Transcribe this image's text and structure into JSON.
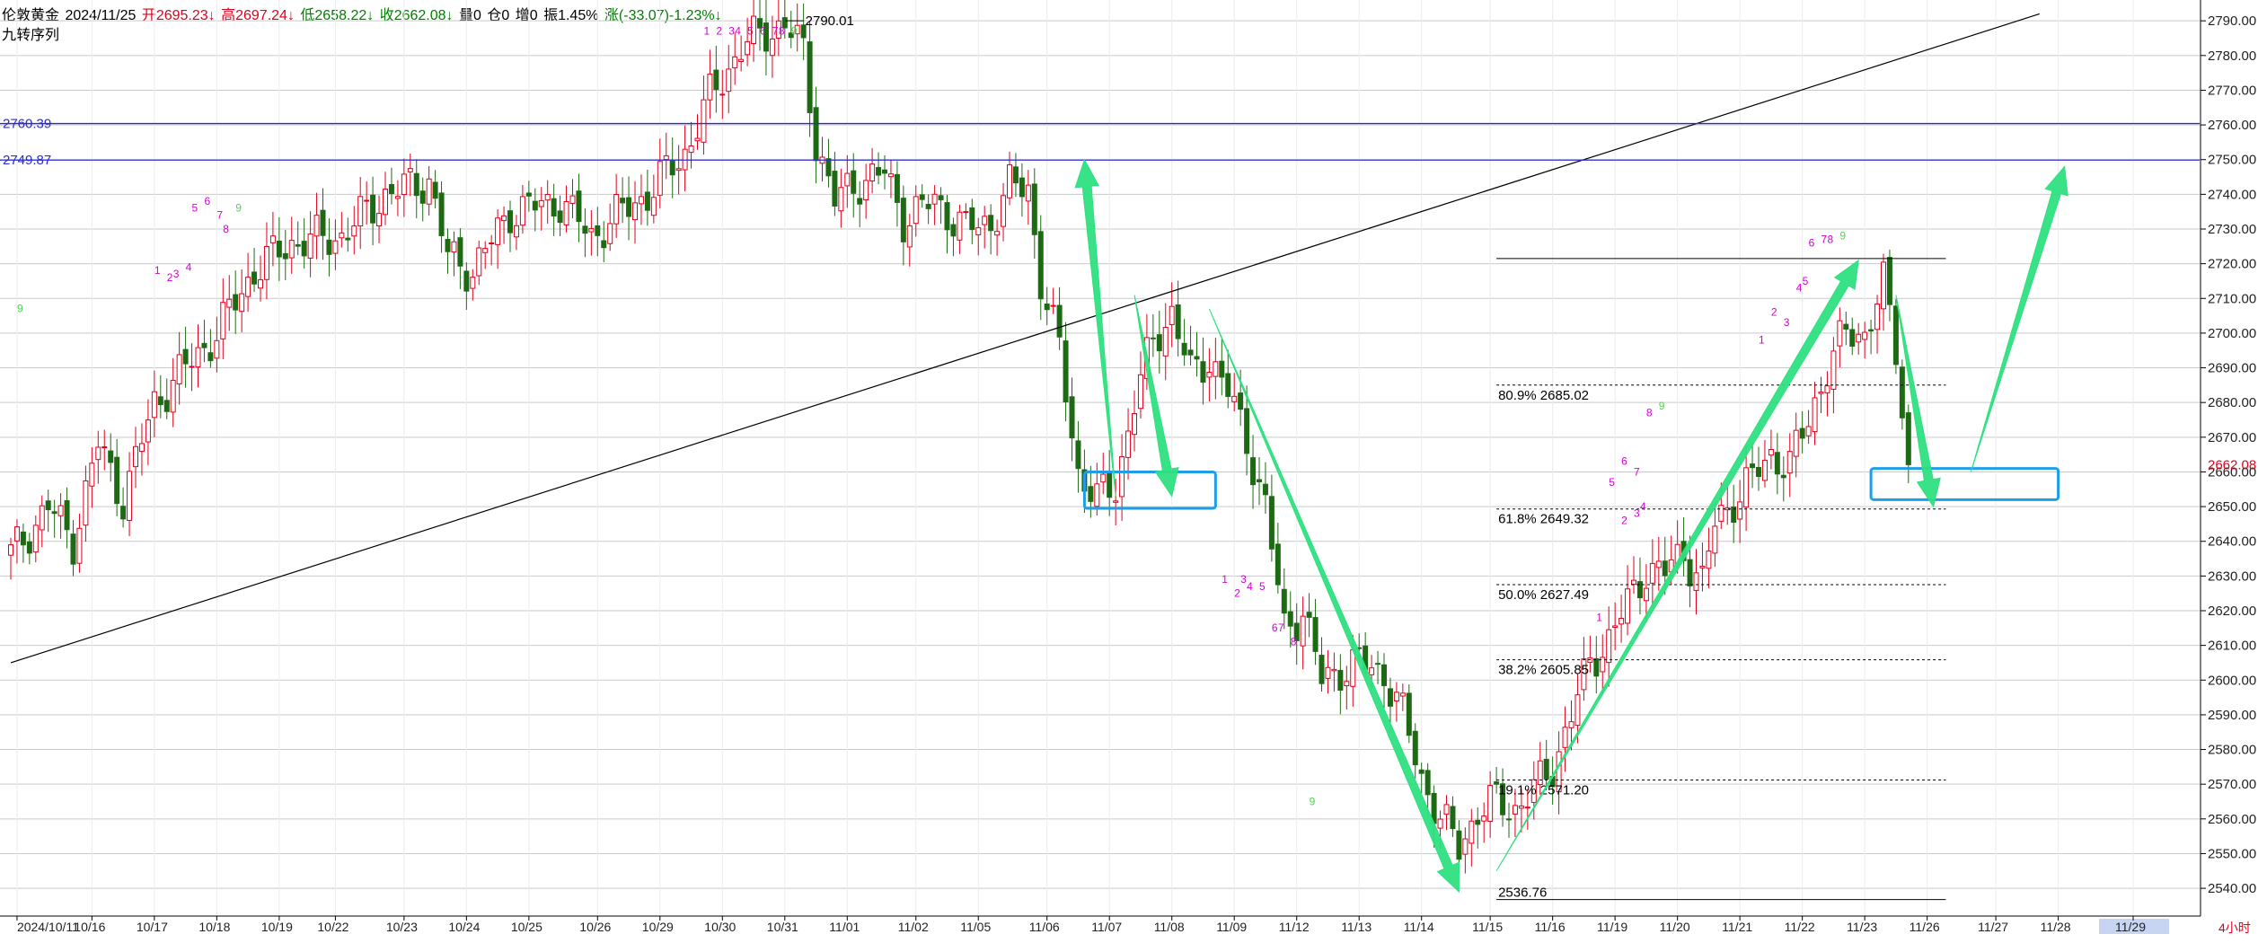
{
  "header": {
    "symbol": "伦敦黄金",
    "date": "2024/11/25",
    "open": "开2695.23↓",
    "high": "高2697.24↓",
    "low": "低2658.22↓",
    "close": "收2662.08↓",
    "volume": "量0",
    "position": "仓0",
    "increase": "增0",
    "amplitude": "振1.45%",
    "change": "涨(-33.07)-1.23%↓",
    "indicator": "九转序列"
  },
  "colors": {
    "bull": "#e0001b",
    "bear": "#1e6a14",
    "hline": "#2b2bd4",
    "trend": "#000000",
    "arrow": "#2ee07f",
    "box": "#1e9ee6",
    "td_setup": "#d400d4",
    "td_nine": "#4fd44f",
    "grid": "#c9c9c9"
  },
  "chart_data": {
    "type": "candlestick",
    "title": "",
    "ylim": [
      2532,
      2796
    ],
    "y_ticks": [
      "2540.00",
      "2550.00",
      "2560.00",
      "2570.00",
      "2580.00",
      "2590.00",
      "2600.00",
      "2610.00",
      "2620.00",
      "2630.00",
      "2640.00",
      "2650.00",
      "2660.00",
      "2670.00",
      "2680.00",
      "2690.00",
      "2700.00",
      "2710.00",
      "2720.00",
      "2730.00",
      "2740.00",
      "2750.00",
      "2760.00",
      "2770.00",
      "2780.00",
      "2790.00"
    ],
    "x_ticks": [
      {
        "i": 1,
        "label": "2024/10/11"
      },
      {
        "i": 13,
        "label": "10/16"
      },
      {
        "i": 23,
        "label": "10/17"
      },
      {
        "i": 33,
        "label": "10/18"
      },
      {
        "i": 43,
        "label": "10/19"
      },
      {
        "i": 52,
        "label": "10/22"
      },
      {
        "i": 63,
        "label": "10/23"
      },
      {
        "i": 73,
        "label": "10/24"
      },
      {
        "i": 83,
        "label": "10/25"
      },
      {
        "i": 94,
        "label": "10/26"
      },
      {
        "i": 104,
        "label": "10/29"
      },
      {
        "i": 114,
        "label": "10/30"
      },
      {
        "i": 124,
        "label": "10/31"
      },
      {
        "i": 134,
        "label": "11/01"
      },
      {
        "i": 145,
        "label": "11/02"
      },
      {
        "i": 155,
        "label": "11/05"
      },
      {
        "i": 166,
        "label": "11/06"
      },
      {
        "i": 176,
        "label": "11/07"
      },
      {
        "i": 186,
        "label": "11/08"
      },
      {
        "i": 196,
        "label": "11/09"
      },
      {
        "i": 206,
        "label": "11/12"
      },
      {
        "i": 216,
        "label": "11/13"
      },
      {
        "i": 226,
        "label": "11/14"
      },
      {
        "i": 237,
        "label": "11/15"
      },
      {
        "i": 247,
        "label": "11/16"
      },
      {
        "i": 257,
        "label": "11/19"
      },
      {
        "i": 267,
        "label": "11/20"
      },
      {
        "i": 277,
        "label": "11/21"
      },
      {
        "i": 287,
        "label": "11/22"
      },
      {
        "i": 297,
        "label": "11/23"
      },
      {
        "i": 307,
        "label": "11/26"
      },
      {
        "i": 318,
        "label": "11/27"
      },
      {
        "i": 328,
        "label": "11/28"
      },
      {
        "i": 340,
        "label": "11/29"
      }
    ],
    "x_axis_unit": "4小时",
    "x_axis_highlight": "11/29",
    "anchors": [
      {
        "i": 0,
        "p": 2636
      },
      {
        "i": 6,
        "p": 2650
      },
      {
        "i": 10,
        "p": 2640
      },
      {
        "i": 14,
        "p": 2668
      },
      {
        "i": 18,
        "p": 2652
      },
      {
        "i": 23,
        "p": 2680
      },
      {
        "i": 28,
        "p": 2690
      },
      {
        "i": 33,
        "p": 2700
      },
      {
        "i": 39,
        "p": 2718
      },
      {
        "i": 45,
        "p": 2726
      },
      {
        "i": 53,
        "p": 2728
      },
      {
        "i": 60,
        "p": 2740
      },
      {
        "i": 67,
        "p": 2744
      },
      {
        "i": 70,
        "p": 2722
      },
      {
        "i": 74,
        "p": 2718
      },
      {
        "i": 80,
        "p": 2735
      },
      {
        "i": 88,
        "p": 2738
      },
      {
        "i": 93,
        "p": 2728
      },
      {
        "i": 98,
        "p": 2735
      },
      {
        "i": 102,
        "p": 2740
      },
      {
        "i": 108,
        "p": 2752
      },
      {
        "i": 112,
        "p": 2768
      },
      {
        "i": 117,
        "p": 2782
      },
      {
        "i": 120,
        "p": 2786
      },
      {
        "i": 124,
        "p": 2789
      },
      {
        "i": 127,
        "p": 2781
      },
      {
        "i": 129,
        "p": 2755
      },
      {
        "i": 132,
        "p": 2738
      },
      {
        "i": 136,
        "p": 2744
      },
      {
        "i": 140,
        "p": 2746
      },
      {
        "i": 143,
        "p": 2733
      },
      {
        "i": 148,
        "p": 2738
      },
      {
        "i": 153,
        "p": 2730
      },
      {
        "i": 157,
        "p": 2732
      },
      {
        "i": 160,
        "p": 2742
      },
      {
        "i": 163,
        "p": 2742
      },
      {
        "i": 165,
        "p": 2715
      },
      {
        "i": 168,
        "p": 2695
      },
      {
        "i": 171,
        "p": 2660
      },
      {
        "i": 174,
        "p": 2652
      },
      {
        "i": 177,
        "p": 2656
      },
      {
        "i": 180,
        "p": 2680
      },
      {
        "i": 183,
        "p": 2698
      },
      {
        "i": 186,
        "p": 2706
      },
      {
        "i": 189,
        "p": 2688
      },
      {
        "i": 192,
        "p": 2693
      },
      {
        "i": 195,
        "p": 2683
      },
      {
        "i": 198,
        "p": 2669
      },
      {
        "i": 201,
        "p": 2650
      },
      {
        "i": 204,
        "p": 2615
      },
      {
        "i": 207,
        "p": 2620
      },
      {
        "i": 210,
        "p": 2600
      },
      {
        "i": 213,
        "p": 2603
      },
      {
        "i": 216,
        "p": 2605
      },
      {
        "i": 220,
        "p": 2602
      },
      {
        "i": 223,
        "p": 2590
      },
      {
        "i": 226,
        "p": 2572
      },
      {
        "i": 229,
        "p": 2560
      },
      {
        "i": 232,
        "p": 2552
      },
      {
        "i": 235,
        "p": 2562
      },
      {
        "i": 238,
        "p": 2565
      },
      {
        "i": 241,
        "p": 2563
      },
      {
        "i": 244,
        "p": 2568
      },
      {
        "i": 247,
        "p": 2575
      },
      {
        "i": 250,
        "p": 2590
      },
      {
        "i": 253,
        "p": 2605
      },
      {
        "i": 256,
        "p": 2612
      },
      {
        "i": 259,
        "p": 2622
      },
      {
        "i": 262,
        "p": 2632
      },
      {
        "i": 265,
        "p": 2631
      },
      {
        "i": 268,
        "p": 2637
      },
      {
        "i": 271,
        "p": 2628
      },
      {
        "i": 273,
        "p": 2645
      },
      {
        "i": 276,
        "p": 2652
      },
      {
        "i": 279,
        "p": 2658
      },
      {
        "i": 282,
        "p": 2665
      },
      {
        "i": 285,
        "p": 2662
      },
      {
        "i": 288,
        "p": 2675
      },
      {
        "i": 291,
        "p": 2690
      },
      {
        "i": 294,
        "p": 2700
      },
      {
        "i": 297,
        "p": 2700
      },
      {
        "i": 300,
        "p": 2714
      },
      {
        "i": 302,
        "p": 2695
      },
      {
        "i": 304,
        "p": 2662
      }
    ],
    "last_price": "2662.08",
    "h_lines": [
      {
        "value": 2760.39,
        "label": "2760.39"
      },
      {
        "value": 2749.87,
        "label": "2749.87"
      }
    ],
    "high_label": {
      "i": 127,
      "value": 2790.01,
      "label": "2790.01"
    },
    "trend_line": {
      "from": {
        "i": 0,
        "v": 2605
      },
      "to": {
        "i": 325,
        "v": 2792
      }
    },
    "fibonacci": {
      "start_i": 238,
      "end_i": 310,
      "top_value": 2721.5,
      "bottom_value": 2536.76,
      "bottom_label": "2536.76",
      "levels": [
        {
          "value": 2685.02,
          "label": "80.9% 2685.02"
        },
        {
          "value": 2649.32,
          "label": "61.8% 2649.32"
        },
        {
          "value": 2627.49,
          "label": "50.0% 2627.49"
        },
        {
          "value": 2605.85,
          "label": "38.2% 2605.85"
        },
        {
          "value": 2571.2,
          "label": "19.1% 2571.20"
        }
      ]
    },
    "boxes": [
      {
        "i0": 172,
        "i1": 193,
        "v_top": 2660,
        "v_bottom": 2649.5
      },
      {
        "i0": 298,
        "i1": 328,
        "v_top": 2661,
        "v_bottom": 2652
      }
    ],
    "arrows": [
      {
        "from": {
          "i": 177,
          "v": 2653
        },
        "to": {
          "i": 172,
          "v": 2750
        }
      },
      {
        "from": {
          "i": 180,
          "v": 2711
        },
        "to": {
          "i": 186,
          "v": 2653
        }
      },
      {
        "from": {
          "i": 192,
          "v": 2707
        },
        "to": {
          "i": 232,
          "v": 2539
        }
      },
      {
        "from": {
          "i": 238,
          "v": 2545
        },
        "to": {
          "i": 296,
          "v": 2721
        }
      },
      {
        "from": {
          "i": 302,
          "v": 2711
        },
        "to": {
          "i": 308,
          "v": 2650
        }
      },
      {
        "from": {
          "i": 314,
          "v": 2660
        },
        "to": {
          "i": 329,
          "v": 2748
        }
      }
    ],
    "td_labels": [
      {
        "i": 1,
        "v": 2706,
        "t": "9",
        "c": "nine"
      },
      {
        "i": 23,
        "v": 2717,
        "t": "1",
        "c": "setup"
      },
      {
        "i": 25,
        "v": 2715,
        "t": "2",
        "c": "setup"
      },
      {
        "i": 26,
        "v": 2716,
        "t": "3",
        "c": "setup"
      },
      {
        "i": 28,
        "v": 2718,
        "t": "4",
        "c": "setup"
      },
      {
        "i": 29,
        "v": 2735,
        "t": "5",
        "c": "setup"
      },
      {
        "i": 31,
        "v": 2737,
        "t": "6",
        "c": "setup"
      },
      {
        "i": 33,
        "v": 2733,
        "t": "7",
        "c": "setup"
      },
      {
        "i": 34,
        "v": 2729,
        "t": "8",
        "c": "setup"
      },
      {
        "i": 36,
        "v": 2735,
        "t": "9",
        "c": "nine"
      },
      {
        "i": 111,
        "v": 2786,
        "t": "1",
        "c": "setup"
      },
      {
        "i": 113,
        "v": 2786,
        "t": "2",
        "c": "setup"
      },
      {
        "i": 115,
        "v": 2786,
        "t": "3",
        "c": "setup"
      },
      {
        "i": 116,
        "v": 2786,
        "t": "4",
        "c": "setup"
      },
      {
        "i": 118,
        "v": 2786,
        "t": "5",
        "c": "setup"
      },
      {
        "i": 120,
        "v": 2786,
        "t": "6",
        "c": "setup"
      },
      {
        "i": 122,
        "v": 2786,
        "t": "7",
        "c": "setup"
      },
      {
        "i": 123,
        "v": 2786,
        "t": "8",
        "c": "setup"
      },
      {
        "i": 125,
        "v": 2786,
        "t": "9",
        "c": "nine"
      },
      {
        "i": 194,
        "v": 2628,
        "t": "1",
        "c": "setup"
      },
      {
        "i": 196,
        "v": 2624,
        "t": "2",
        "c": "setup"
      },
      {
        "i": 197,
        "v": 2628,
        "t": "3",
        "c": "setup"
      },
      {
        "i": 198,
        "v": 2626,
        "t": "4",
        "c": "setup"
      },
      {
        "i": 200,
        "v": 2626,
        "t": "5",
        "c": "setup"
      },
      {
        "i": 202,
        "v": 2614,
        "t": "6",
        "c": "setup"
      },
      {
        "i": 203,
        "v": 2614,
        "t": "7",
        "c": "setup"
      },
      {
        "i": 205,
        "v": 2610,
        "t": "8",
        "c": "setup"
      },
      {
        "i": 208,
        "v": 2564,
        "t": "9",
        "c": "nine"
      },
      {
        "i": 254,
        "v": 2617,
        "t": "1",
        "c": "setup"
      },
      {
        "i": 258,
        "v": 2645,
        "t": "2",
        "c": "setup"
      },
      {
        "i": 260,
        "v": 2647,
        "t": "3",
        "c": "setup"
      },
      {
        "i": 261,
        "v": 2649,
        "t": "4",
        "c": "setup"
      },
      {
        "i": 256,
        "v": 2656,
        "t": "5",
        "c": "setup"
      },
      {
        "i": 258,
        "v": 2662,
        "t": "6",
        "c": "setup"
      },
      {
        "i": 260,
        "v": 2659,
        "t": "7",
        "c": "setup"
      },
      {
        "i": 262,
        "v": 2676,
        "t": "8",
        "c": "setup"
      },
      {
        "i": 264,
        "v": 2678,
        "t": "9",
        "c": "nine"
      },
      {
        "i": 280,
        "v": 2697,
        "t": "1",
        "c": "setup"
      },
      {
        "i": 282,
        "v": 2705,
        "t": "2",
        "c": "setup"
      },
      {
        "i": 284,
        "v": 2702,
        "t": "3",
        "c": "setup"
      },
      {
        "i": 286,
        "v": 2712,
        "t": "4",
        "c": "setup"
      },
      {
        "i": 287,
        "v": 2714,
        "t": "5",
        "c": "setup"
      },
      {
        "i": 288,
        "v": 2725,
        "t": "6",
        "c": "setup"
      },
      {
        "i": 290,
        "v": 2726,
        "t": "7",
        "c": "setup"
      },
      {
        "i": 291,
        "v": 2726,
        "t": "8",
        "c": "setup"
      },
      {
        "i": 293,
        "v": 2727,
        "t": "9",
        "c": "nine"
      }
    ]
  }
}
